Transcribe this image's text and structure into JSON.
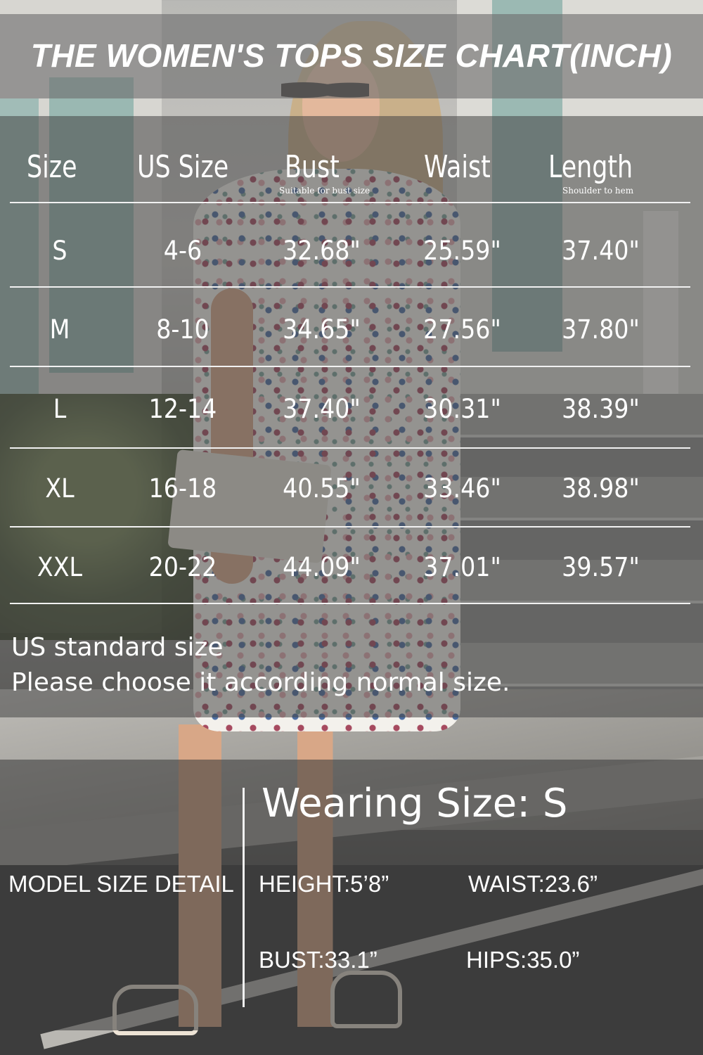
{
  "title": "THE WOMEN'S TOPS SIZE CHART(INCH)",
  "table": {
    "headers": [
      {
        "label": "Size",
        "sub": ""
      },
      {
        "label": "US Size",
        "sub": ""
      },
      {
        "label": "Bust",
        "sub": "Suitable for bust size"
      },
      {
        "label": "Waist",
        "sub": ""
      },
      {
        "label": "Length",
        "sub": "Shoulder to hem"
      }
    ],
    "rows": [
      [
        "S",
        "4-6",
        "32.68\"",
        "25.59\"",
        "37.40\""
      ],
      [
        "M",
        "8-10",
        "34.65\"",
        "27.56\"",
        "37.80\""
      ],
      [
        "L",
        "12-14",
        "37.40\"",
        "30.31\"",
        "38.39\""
      ],
      [
        "XL",
        "16-18",
        "40.55\"",
        "33.46\"",
        "38.98\""
      ],
      [
        "XXL",
        "20-22",
        "44.09\"",
        "37.01\"",
        "39.57\""
      ]
    ]
  },
  "notes": {
    "line1": "US standard size",
    "line2": "Please choose it according normal size."
  },
  "model": {
    "heading": "MODEL SIZE DETAIL",
    "wearing": "Wearing Size: S",
    "height": "HEIGHT:5’8”",
    "waist": "WAIST:23.6”",
    "bust": "BUST:33.1”",
    "hips": "HIPS:35.0”"
  }
}
